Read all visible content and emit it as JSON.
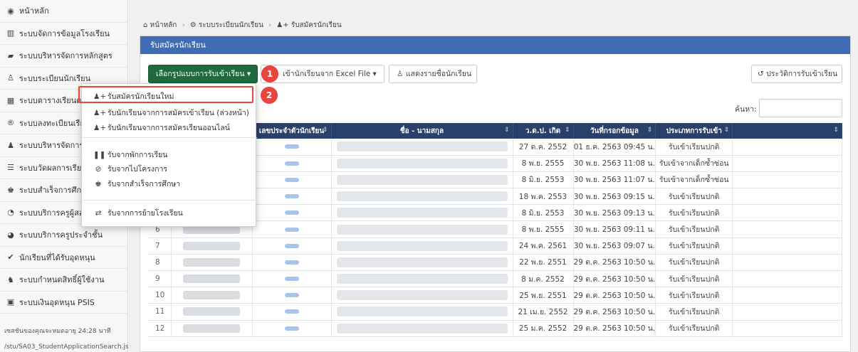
{
  "sidebar": {
    "items": [
      {
        "icon": "dashboard-icon",
        "glyph": "◉",
        "label": "หน้าหลัก"
      },
      {
        "icon": "bank-icon",
        "glyph": "▥",
        "label": "ระบบจัดการข้อมูลโรงเรียน"
      },
      {
        "icon": "book-icon",
        "glyph": "▰",
        "label": "ระบบบริหารจัดการหลักสูตร"
      },
      {
        "icon": "user-outline-icon",
        "glyph": "♙",
        "label": "ระบบระเบียนนักเรียน"
      },
      {
        "icon": "calendar-icon",
        "glyph": "▦",
        "label": "ระบบตารางเรียนตา"
      },
      {
        "icon": "registered-icon",
        "glyph": "®",
        "label": "ระบบลงทะเบียนเรียน"
      },
      {
        "icon": "user-icon",
        "glyph": "♟",
        "label": "ระบบบริหารจัดการบุ"
      },
      {
        "icon": "list-icon",
        "glyph": "☰",
        "label": "ระบบวัดผลการเรียน"
      },
      {
        "icon": "graduation-cap-icon",
        "glyph": "♚",
        "label": "ระบบสำเร็จการศึกษ"
      },
      {
        "icon": "user-circle-icon",
        "glyph": "◔",
        "label": "ระบบบริการครูผู้สอน"
      },
      {
        "icon": "user-badge-icon",
        "glyph": "◕",
        "label": "ระบบบริการครูประจำชั้น"
      },
      {
        "icon": "check-circle-icon",
        "glyph": "✔",
        "label": "นักเรียนที่ได้รับอุดหนุน"
      },
      {
        "icon": "users-icon",
        "glyph": "♞",
        "label": "ระบบกำหนดสิทธิ์ผู้ใช้งาน"
      },
      {
        "icon": "money-icon",
        "glyph": "▣",
        "label": "ระบบเงินอุดหนุน PSIS"
      }
    ],
    "session_text": "เซสชันของคุณจะหมดอายุ 24:28 นาที",
    "path_text": "/stu/SA03_StudentApplicationSearch.jsp"
  },
  "breadcrumb": {
    "home": "หน้าหลัก",
    "section": "ระบบระเบียนนักเรียน",
    "current": "รับสมัครนักเรียน"
  },
  "panel": {
    "title": "รับสมัครนักเรียน"
  },
  "toolbar": {
    "select_format_label": "เลือกรูปแบบการรับเข้าเรียน ▾",
    "import_excel_label": "เข้านักเรียนจาก Excel File ▾",
    "show_list_label": "แสดงรายชื่อนักเรียน",
    "history_label": "ประวัติการรับเข้าเรียน"
  },
  "callouts": {
    "one": "1",
    "two": "2"
  },
  "search": {
    "label": "ค้นหา:",
    "placeholder": ""
  },
  "dropdown": {
    "items": [
      {
        "icon": "user-add-icon",
        "glyph": "♟+",
        "label": "รับสมัครนักเรียนใหม่"
      },
      {
        "icon": "user-add-icon",
        "glyph": "♟+",
        "label": "รับนักเรียนจากการสมัครเข้าเรียน (ล่วงหน้า)"
      },
      {
        "icon": "user-add-icon",
        "glyph": "♟+",
        "label": "รับนักเรียนจากการสมัครเรียนออนไลน์"
      },
      {
        "icon": "pause-icon",
        "glyph": "❚❚",
        "label": "รับจากพักการเรียน"
      },
      {
        "icon": "ban-icon",
        "glyph": "⊘",
        "label": "รับจากไปโครงการ"
      },
      {
        "icon": "graduation-cap-icon",
        "glyph": "♚",
        "label": "รับจากสำเร็จการศึกษา"
      },
      {
        "icon": "exchange-icon",
        "glyph": "⇄",
        "label": "รับจากการย้ายโรงเรียน"
      }
    ]
  },
  "table": {
    "headers": [
      "",
      "",
      "เลขประจำตัวนักเรียน",
      "ชื่อ - นามสกุล",
      "ว.ด.ป. เกิด",
      "วันที่กรอกข้อมูล",
      "ประเภทการรับเข้า",
      ""
    ],
    "rows": [
      {
        "no": "",
        "id_visible": "",
        "dob": "27 ต.ค. 2552",
        "entered": "01 ธ.ค. 2563 09:45 น.",
        "type": "รับเข้าเรียนปกติ"
      },
      {
        "no": "",
        "id_visible": "",
        "dob": "8 พ.ย. 2555",
        "entered": "30 พ.ย. 2563 11:08 น.",
        "type": "รับเข้าจากเด็กซ้ำซ่อน"
      },
      {
        "no": "",
        "id_visible": "",
        "dob": "8 มิ.ย. 2553",
        "entered": "30 พ.ย. 2563 11:07 น.",
        "type": "รับเข้าจากเด็กซ้ำซ่อน"
      },
      {
        "no": "",
        "id_visible": "",
        "dob": "18 พ.ค. 2553",
        "entered": "30 พ.ย. 2563 09:15 น.",
        "type": "รับเข้าเรียนปกติ"
      },
      {
        "no": "5",
        "id_visible": "1009900979052",
        "dob": "8 มิ.ย. 2553",
        "entered": "30 พ.ย. 2563 09:13 น.",
        "type": "รับเข้าเรียนปกติ"
      },
      {
        "no": "6",
        "id_visible": "",
        "dob": "8 พ.ย. 2555",
        "entered": "30 พ.ย. 2563 09:11 น.",
        "type": "รับเข้าเรียนปกติ"
      },
      {
        "no": "7",
        "id_visible": "",
        "dob": "24 พ.ค. 2561",
        "entered": "30 พ.ย. 2563 09:07 น.",
        "type": "รับเข้าเรียนปกติ"
      },
      {
        "no": "8",
        "id_visible": "",
        "dob": "22 พ.ย. 2551",
        "entered": "29 ต.ค. 2563 10:50 น.",
        "type": "รับเข้าเรียนปกติ"
      },
      {
        "no": "9",
        "id_visible": "",
        "dob": "8 ม.ค. 2552",
        "entered": "29 ต.ค. 2563 10:50 น.",
        "type": "รับเข้าเรียนปกติ"
      },
      {
        "no": "10",
        "id_visible": "",
        "dob": "25 พ.ย. 2551",
        "entered": "29 ต.ค. 2563 10:50 น.",
        "type": "รับเข้าเรียนปกติ"
      },
      {
        "no": "11",
        "id_visible": "",
        "dob": "21 เม.ย. 2552",
        "entered": "29 ต.ค. 2563 10:50 น.",
        "type": "รับเข้าเรียนปกติ"
      },
      {
        "no": "12",
        "id_visible": "",
        "dob": "25 ม.ค. 2552",
        "entered": "29 ต.ค. 2563 10:50 น.",
        "type": "รับเข้าเรียนปกติ"
      }
    ]
  },
  "colors": {
    "accent": "#3e6db4",
    "table_header": "#29406a",
    "primary_button": "#1f6b3f",
    "callout": "#e8453c"
  }
}
